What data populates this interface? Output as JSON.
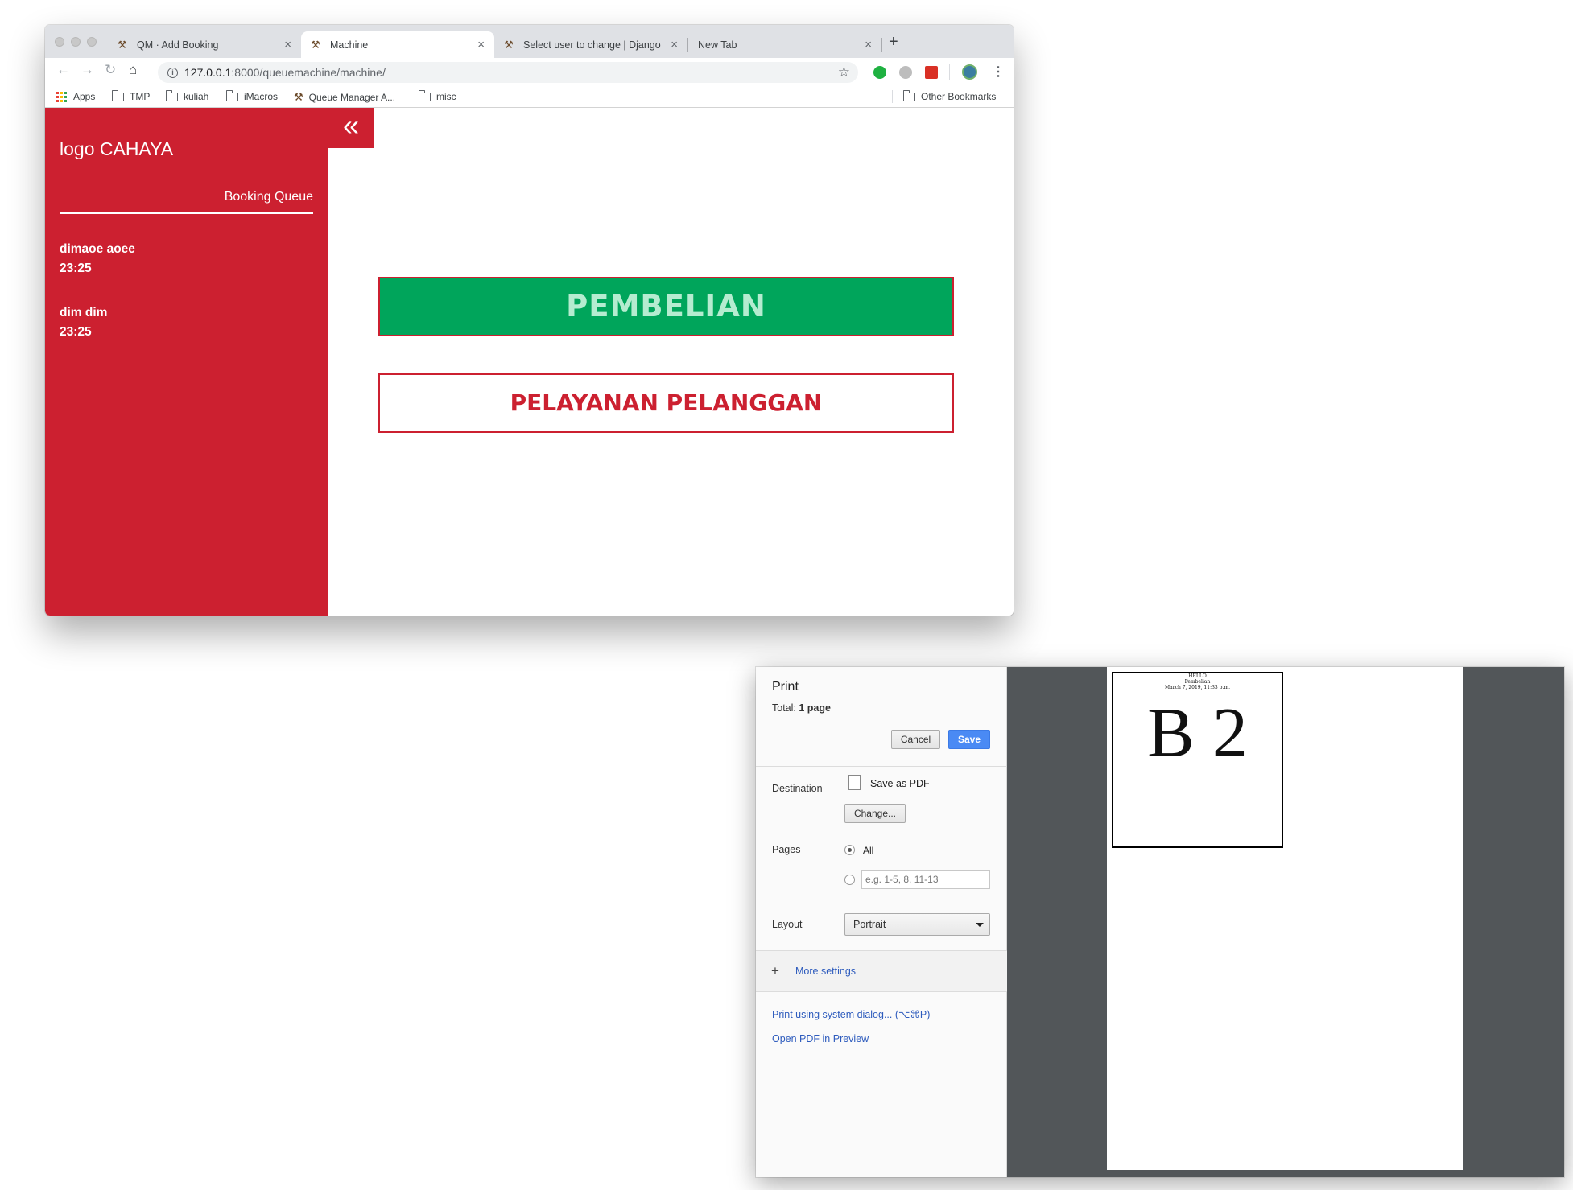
{
  "browser": {
    "tabs": [
      {
        "title": "QM · Add Booking",
        "active": false
      },
      {
        "title": "Machine",
        "active": true
      },
      {
        "title": "Select user to change | Django",
        "active": false
      },
      {
        "title": "New Tab",
        "active": false
      }
    ],
    "new_tab_symbol": "+",
    "url_host": "127.0.0.1",
    "url_rest": ":8000/queuemachine/machine/",
    "bookmarks": {
      "apps": "Apps",
      "tmp": "TMP",
      "kuliah": "kuliah",
      "imacros": "iMacros",
      "queue_manager": "Queue Manager A...",
      "misc": "misc",
      "other": "Other Bookmarks"
    }
  },
  "app": {
    "logo": "logo CAHAYA",
    "collapse_icon": "«",
    "sidebar_title": "Booking Queue",
    "queue": [
      {
        "name": "dimaoe aoee",
        "time": "23:25"
      },
      {
        "name": "dim dim",
        "time": "23:25"
      }
    ],
    "btn_pembelian": "PEMBELIAN",
    "btn_pelayanan": "PELAYANAN PELANGGAN",
    "colors": {
      "brand_red": "#cc2030",
      "green": "#00a55b"
    }
  },
  "print": {
    "title": "Print",
    "total_label": "Total:",
    "total_value": "1 page",
    "cancel": "Cancel",
    "save": "Save",
    "destination_label": "Destination",
    "destination_value": "Save as PDF",
    "change": "Change...",
    "pages_label": "Pages",
    "pages_all": "All",
    "pages_placeholder": "e.g. 1-5, 8, 11-13",
    "layout_label": "Layout",
    "layout_value": "Portrait",
    "more_settings": "More settings",
    "system_dialog": "Print using system dialog... (⌥⌘P)",
    "open_pdf": "Open PDF in Preview",
    "preview": {
      "line1": "HELLO",
      "line2": "Pembelian",
      "line3": "March 7, 2019, 11:33 p.m.",
      "number": "B 2"
    }
  }
}
